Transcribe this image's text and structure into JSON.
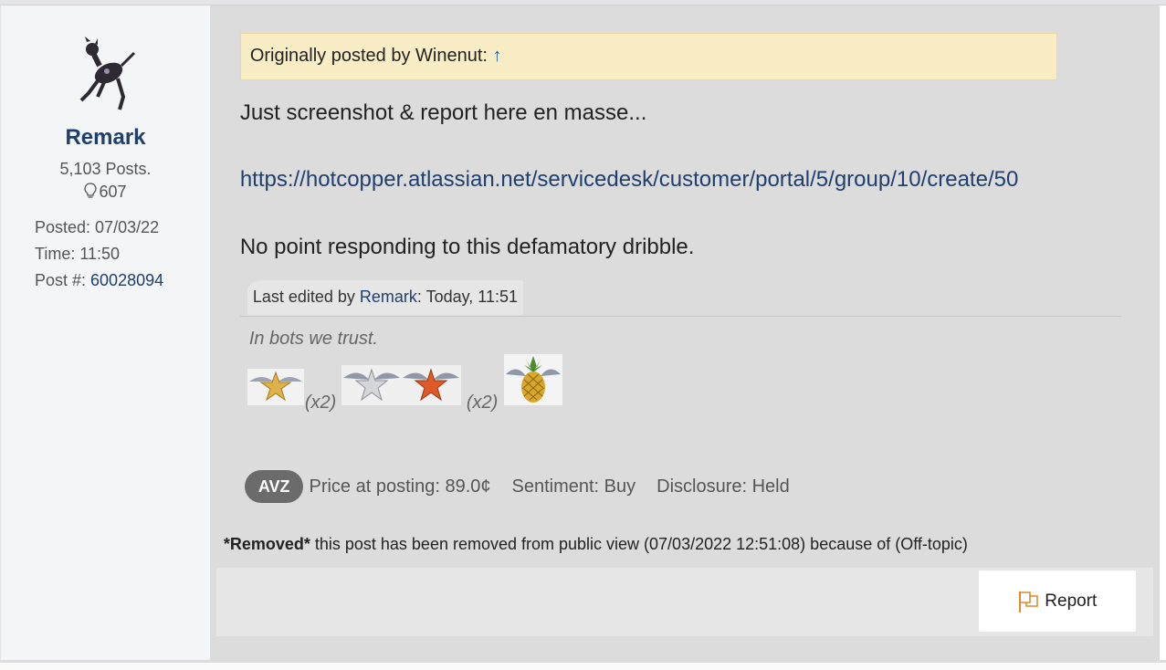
{
  "author": {
    "username": "Remark",
    "posts": "5,103 Posts.",
    "likes": "607",
    "posted_label": "Posted: ",
    "posted_value": "07/03/22",
    "time_label": "Time: ",
    "time_value": "11:50",
    "postnum_label": "Post #: ",
    "postnum_value": "60028094"
  },
  "post": {
    "quote_prefix": "Originally posted by Winenut: ",
    "quote_arrow": "↑",
    "line1": "Just screenshot & report here en masse...",
    "link": "https://hotcopper.atlassian.net/servicedesk/customer/portal/5/group/10/create/50",
    "line2": "No point responding to this defamatory dribble.",
    "edited_prefix": "Last edited by ",
    "edited_user": "Remark",
    "edited_suffix": ": Today, 11:51",
    "signature": "In bots we trust.",
    "badge_mult_1": "(x2)",
    "badge_mult_2": "(x2)"
  },
  "stock": {
    "ticker": "AVZ",
    "price": "Price at posting: 89.0¢",
    "sentiment": "Sentiment: Buy",
    "disclosure": "Disclosure: Held"
  },
  "removed": {
    "tag": "*Removed*",
    "text": " this post has been removed from public view (07/03/2022 12:51:08) because of (Off-topic)"
  },
  "actions": {
    "report_label": "Report"
  },
  "colors": {
    "link": "#1e3f6f",
    "quote_bg": "#f9edc5",
    "ticker_bg": "#6b6b6b",
    "content_bg": "#dcdcdc"
  },
  "icons": [
    "dog-avatar",
    "lightbulb-icon",
    "gold-star-badge",
    "silver-star-badge",
    "bronze-star-badge",
    "pineapple-badge",
    "flag-icon"
  ]
}
